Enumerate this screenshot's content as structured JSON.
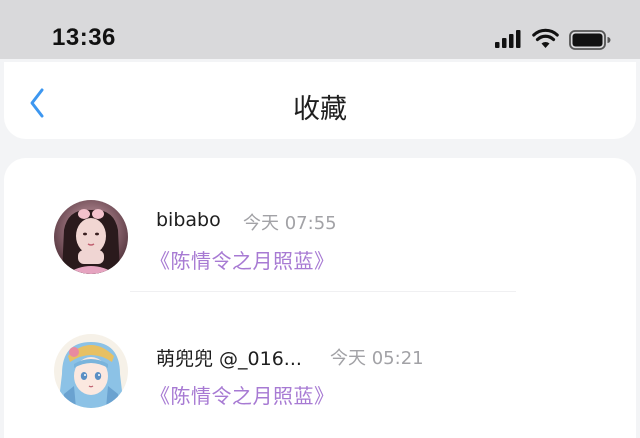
{
  "status_bar": {
    "time": "13:36",
    "icons": [
      "signal-icon",
      "wifi-icon",
      "battery-icon"
    ]
  },
  "nav": {
    "title": "收藏",
    "back_icon": "chevron-left-icon",
    "accent_color": "#3d97f0"
  },
  "favorites": [
    {
      "name": "bibabo",
      "time": "今天 07:55",
      "title": "《陈情令之月照蓝》",
      "avatar_icon": "avatar-photo"
    },
    {
      "name": "萌兜兜 @_016...",
      "time": "今天 05:21",
      "title": "《陈情令之月照蓝》",
      "avatar_icon": "avatar-anime"
    }
  ],
  "colors": {
    "title_purple": "#a77ad3",
    "time_gray": "#a2a2a6",
    "background": "#f3f4f6"
  }
}
